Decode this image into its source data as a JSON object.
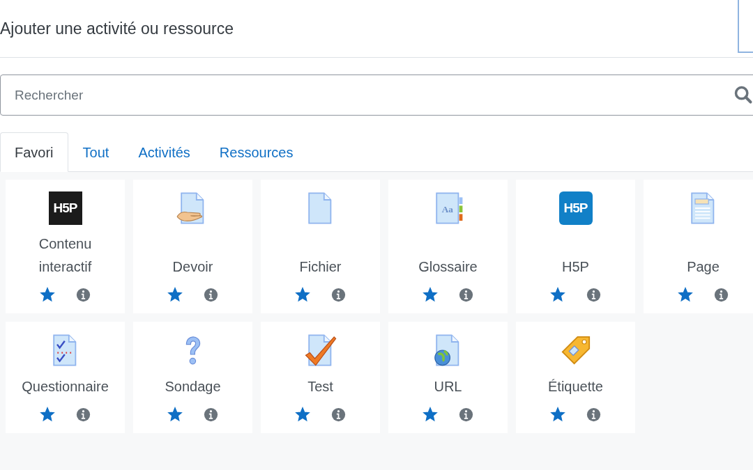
{
  "dialog": {
    "title": "Ajouter une activité ou ressource"
  },
  "search": {
    "placeholder": "Rechercher"
  },
  "tabs": [
    {
      "label": "Favori",
      "selected": true
    },
    {
      "label": "Tout",
      "selected": false
    },
    {
      "label": "Activités",
      "selected": false
    },
    {
      "label": "Ressources",
      "selected": false
    }
  ],
  "modules": [
    {
      "name": "Contenu interactif",
      "kind": "h5p-dark",
      "icon_label": "H5P",
      "starred": true
    },
    {
      "name": "Devoir",
      "kind": "assign",
      "starred": true
    },
    {
      "name": "Fichier",
      "kind": "file",
      "starred": true
    },
    {
      "name": "Glossaire",
      "kind": "glossary",
      "icon_label": "Aa",
      "starred": true
    },
    {
      "name": "H5P",
      "kind": "h5p-blue",
      "icon_label": "H5P",
      "starred": true
    },
    {
      "name": "Page",
      "kind": "page",
      "starred": true
    },
    {
      "name": "Questionnaire",
      "kind": "feedback",
      "starred": true
    },
    {
      "name": "Sondage",
      "kind": "survey",
      "starred": true
    },
    {
      "name": "Test",
      "kind": "quiz",
      "starred": true
    },
    {
      "name": "URL",
      "kind": "url",
      "starred": true
    },
    {
      "name": "Étiquette",
      "kind": "label",
      "starred": true
    }
  ]
}
